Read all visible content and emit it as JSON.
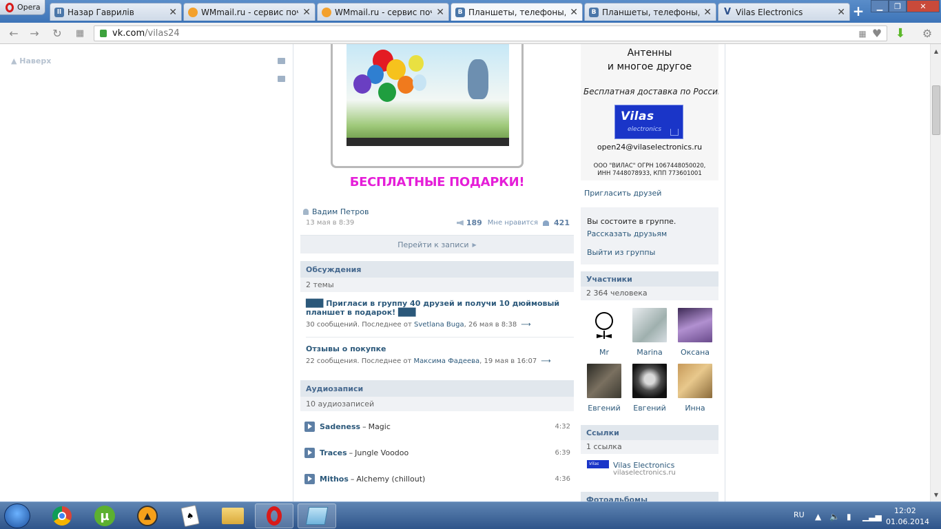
{
  "browser": {
    "opera_label": "Opera",
    "tabs": [
      {
        "title": "Назар Гаврилів",
        "icon": "tab-icon-user",
        "color": "#4a76a8"
      },
      {
        "title": "WMmail.ru - сервис почт",
        "icon": "wmmail-icon",
        "color": "#f3a12d"
      },
      {
        "title": "WMmail.ru - сервис почт",
        "icon": "wmmail-icon",
        "color": "#f3a12d"
      },
      {
        "title": "Планшеты, телефоны, на",
        "icon": "vk-icon",
        "color": "#4a76a8"
      },
      {
        "title": "Планшеты, телефоны, на",
        "icon": "vk-icon",
        "color": "#4a76a8"
      },
      {
        "title": "Vilas Electronics",
        "icon": "vk-icon",
        "color": "#4a76a8"
      }
    ],
    "url_domain": "vk.com",
    "url_path": "/vilas24"
  },
  "left": {
    "top_link": "Наверх"
  },
  "post": {
    "promo_text": "БЕСПЛАТНЫЕ ПОДАРКИ!",
    "author": "Вадим Петров",
    "date": "13 мая в 8:39",
    "reposts": "189",
    "likes_label": "Мне нравится",
    "likes": "421",
    "goto_label": "Перейти к записи"
  },
  "discussions": {
    "title": "Обсуждения",
    "count": "2 темы",
    "topics": [
      {
        "title": "███ Пригласи в группу 40 друзей и получи 10 дюймовый планшет в подарок! ███",
        "meta_prefix": "30 сообщений. Последнее от",
        "author": "Svetlana Buga",
        "when": ", 26 мая в 8:38"
      },
      {
        "title": "Отзывы о покупке",
        "meta_prefix": "22 сообщения. Последнее от",
        "author": "Максима Фадеева",
        "when": ", 19 мая в 16:07"
      }
    ]
  },
  "audio": {
    "title": "Аудиозаписи",
    "count": "10 аудиозаписей",
    "tracks": [
      {
        "artist": "Sadeness",
        "song": "Magic",
        "duration": "4:32"
      },
      {
        "artist": "Traces",
        "song": "Jungle Voodoo",
        "duration": "6:39"
      },
      {
        "artist": "Mithos",
        "song": "Alchemy (chillout)",
        "duration": "4:36"
      }
    ]
  },
  "ad": {
    "line1": "Антенны",
    "line2": "и многое другое",
    "line3": "Бесплатная доставка по России",
    "logo_big": "Vilas",
    "logo_small": "electronics",
    "email": "open24@vilaselectronics.ru",
    "reg_line1": "ООО \"ВИЛАС\"  ОГРН 1067448050020,",
    "reg_line2": "ИНН 7448078933, КПП 773601001"
  },
  "group": {
    "invite": "Пригласить друзей",
    "member_status": "Вы состоите в группе.",
    "tell_friends": "Рассказать друзьям",
    "leave": "Выйти из группы"
  },
  "members": {
    "title": "Участники",
    "count": "2 364 человека",
    "people": [
      {
        "name": "Mr"
      },
      {
        "name": "Marina"
      },
      {
        "name": "Оксана"
      },
      {
        "name": "Евгений"
      },
      {
        "name": "Евгений"
      },
      {
        "name": "Инна"
      }
    ]
  },
  "links": {
    "title": "Ссылки",
    "count": "1 ссылка",
    "items": [
      {
        "name": "Vilas Electronics",
        "url": "vilaselectronics.ru"
      }
    ]
  },
  "albums": {
    "title": "Фотоальбомы"
  },
  "taskbar": {
    "lang": "RU",
    "time": "12:02",
    "date": "01.06.2014"
  }
}
